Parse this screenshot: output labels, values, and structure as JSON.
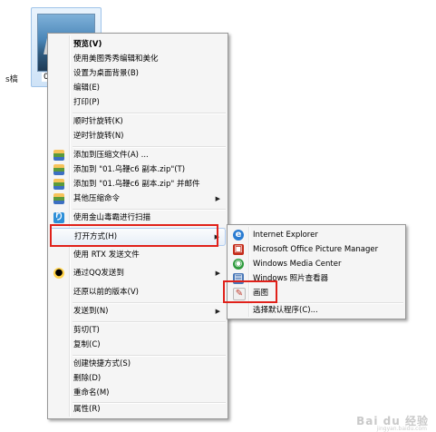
{
  "desktop": {
    "left_text": "s槁",
    "file_label": "01"
  },
  "context_menu": {
    "items": [
      {
        "label": "预览(V)",
        "bold": true
      },
      {
        "label": "使用美图秀秀编辑和美化"
      },
      {
        "label": "设置为桌面背景(B)"
      },
      {
        "label": "编辑(E)"
      },
      {
        "label": "打印(P)"
      },
      {
        "label": "顺时针旋转(K)"
      },
      {
        "label": "逆时针旋转(N)"
      },
      {
        "label": "添加到压缩文件(A) ...",
        "icon": "zip-icon"
      },
      {
        "label": "添加到 \"01.乌鞭c6 副本.zip\"(T)",
        "icon": "zip-icon"
      },
      {
        "label": "添加到 \"01.乌鞭c6 副本.zip\" 并邮件",
        "icon": "zip-icon"
      },
      {
        "label": "其他压缩命令",
        "icon": "zip-icon",
        "submenu": true
      },
      {
        "label": "使用金山毒霸进行扫描",
        "icon": "kingsoft-shield-icon"
      },
      {
        "label": "打开方式(H)",
        "submenu": true,
        "highlighted": true
      },
      {
        "label": "使用 RTX 发送文件"
      },
      {
        "label": "通过QQ发送到",
        "icon": "qq-icon",
        "submenu": true
      },
      {
        "label": "还原以前的版本(V)"
      },
      {
        "label": "发送到(N)",
        "submenu": true
      },
      {
        "label": "剪切(T)"
      },
      {
        "label": "复制(C)"
      },
      {
        "label": "创建快捷方式(S)"
      },
      {
        "label": "删除(D)"
      },
      {
        "label": "重命名(M)"
      },
      {
        "label": "属性(R)"
      }
    ]
  },
  "open_with_menu": {
    "items": [
      {
        "label": "Internet Explorer",
        "icon": "internet-explorer-icon"
      },
      {
        "label": "Microsoft Office Picture Manager",
        "icon": "picture-manager-icon"
      },
      {
        "label": "Windows Media Center",
        "icon": "media-center-icon"
      },
      {
        "label": "Windows 照片查看器",
        "icon": "photo-viewer-icon"
      },
      {
        "label": "画图",
        "icon": "paint-icon"
      },
      {
        "label": "选择默认程序(C)..."
      }
    ]
  },
  "watermark": {
    "text": "Bai du 经验",
    "sub": "jingyan.baidu.com"
  },
  "colors": {
    "annotation_red": "#e0211a",
    "menu_bg": "#f5f5f5"
  }
}
